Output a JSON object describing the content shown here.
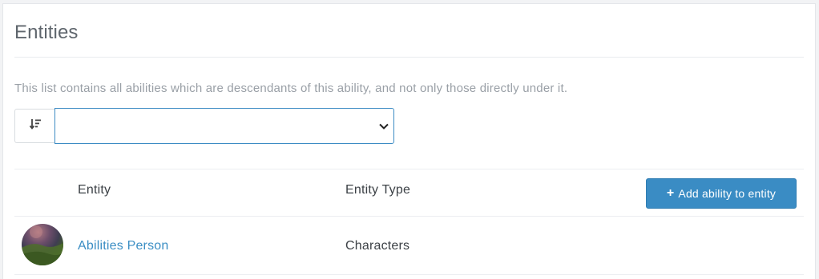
{
  "panel": {
    "title": "Entities",
    "helper_text": "This list contains all abilities which are descendants of this ability, and not only those directly under it."
  },
  "ordering": {
    "order_button_icon": "sort-amount-down-icon",
    "selected_value": "",
    "dropdown_icon": "chevron-down-icon"
  },
  "table": {
    "columns": [
      "",
      "Entity",
      "Entity Type"
    ],
    "add_button": {
      "icon": "plus-icon",
      "label": "Add ability to entity",
      "color": "#3a8cc4"
    },
    "rows": [
      {
        "avatar": "entity-avatar",
        "name": "Abilities Person",
        "type": "Characters"
      }
    ]
  },
  "colors": {
    "link": "#3b8ec4",
    "focus_border": "#3d8cc4"
  }
}
